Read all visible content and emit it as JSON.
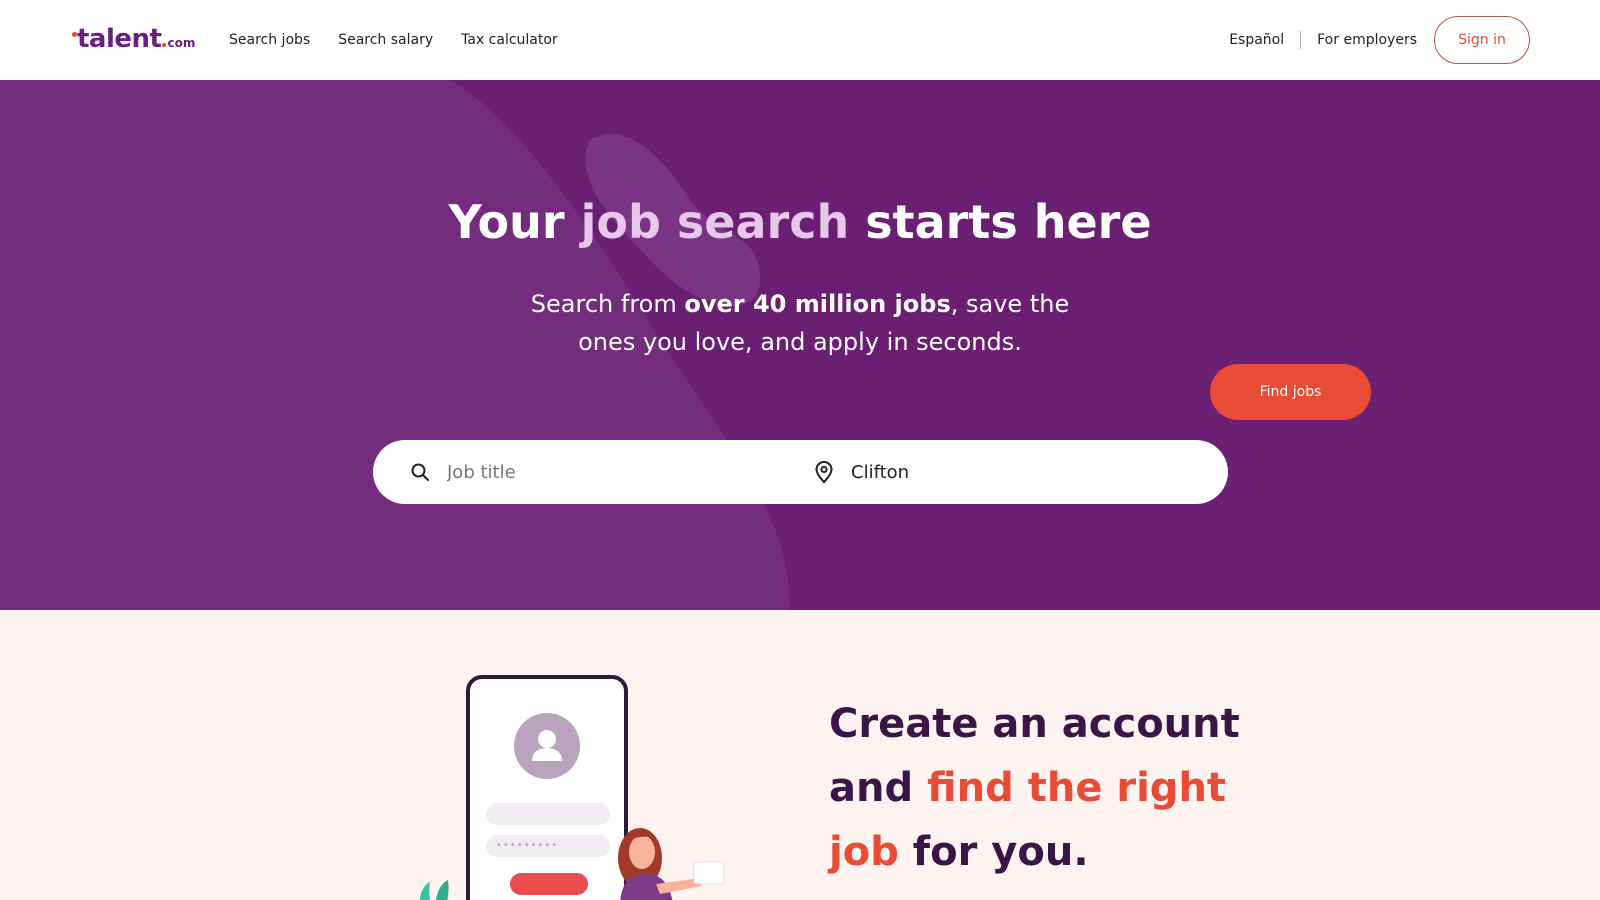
{
  "header": {
    "logo_text": "talent",
    "logo_tld": "com",
    "nav": [
      "Search jobs",
      "Search salary",
      "Tax calculator"
    ],
    "language": "Español",
    "employers": "For employers",
    "sign_in": "Sign in"
  },
  "hero": {
    "title_part1": "Your ",
    "title_accent": "job search",
    "title_part2": " starts here",
    "subtitle_part1": "Search from ",
    "subtitle_bold": "over 40 million jobs",
    "subtitle_part2": ", save the ones you love, and apply in seconds.",
    "search": {
      "job_placeholder": "Job title",
      "location_value": "Clifton",
      "button": "Find jobs"
    }
  },
  "promo": {
    "line1": "Create an account",
    "line2_plain": "and ",
    "line2_accent": "find the right",
    "line3_accent": "job",
    "line3_plain": " for you.",
    "password_dots": "•••••••••"
  },
  "colors": {
    "brand_purple": "#6a1f73",
    "accent_orange": "#e94b35",
    "hero_accent": "#e7c7ea",
    "dark_text": "#3b1548",
    "section_bg": "#fdf3f0"
  },
  "icons": [
    "search-icon",
    "location-pin-icon",
    "user-icon"
  ]
}
